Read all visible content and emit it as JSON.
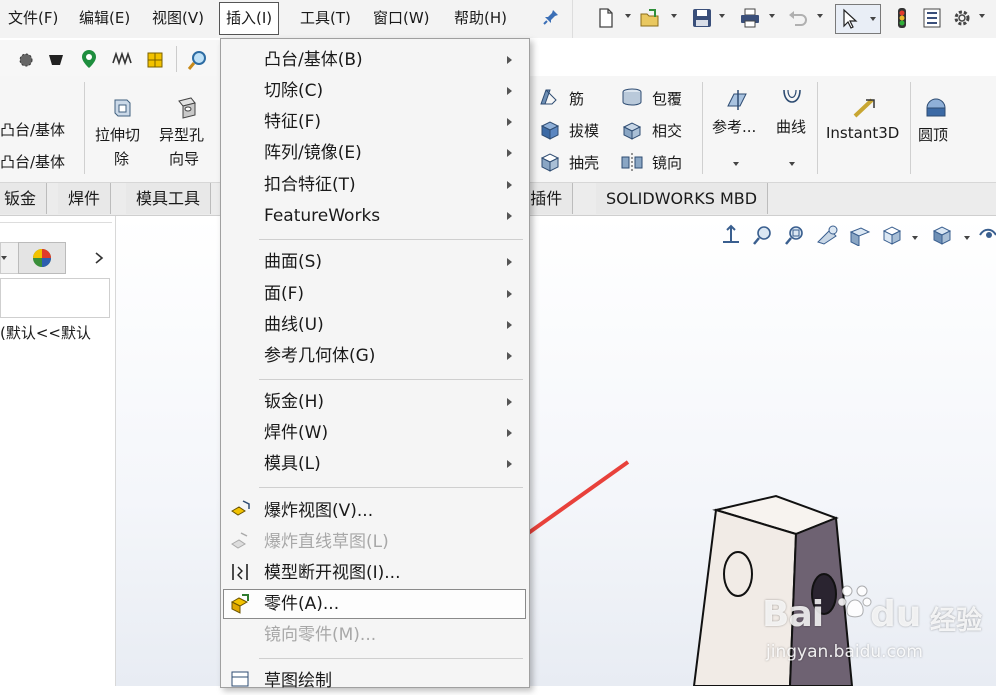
{
  "menubar": {
    "items": [
      {
        "label": "文件(F)"
      },
      {
        "label": "编辑(E)"
      },
      {
        "label": "视图(V)"
      },
      {
        "label": "插入(I)"
      },
      {
        "label": "工具(T)"
      },
      {
        "label": "窗口(W)"
      },
      {
        "label": "帮助(H)"
      }
    ]
  },
  "ribbon": {
    "left_cut_1": "凸台/基体",
    "left_cut_2": "凸台/基体",
    "extrude_cut_1": "拉伸切",
    "extrude_cut_2": "除",
    "hole_wizard_1": "异型孔",
    "hole_wizard_2": "向导",
    "rib": "筋",
    "wrap": "包覆",
    "draft": "拔模",
    "intersect": "相交",
    "shell": "抽壳",
    "mirror": "镜向",
    "reference": "参考...",
    "curves": "曲线",
    "instant3d": "Instant3D",
    "dome": "圆顶"
  },
  "tabs": {
    "sheet_metal": "钣金",
    "weldments": "焊件",
    "mold_tools": "模具工具",
    "addins_cut": "S 插件",
    "mbd": "SOLIDWORKS MBD"
  },
  "leftpanel": {
    "config_text": "(默认<<默认"
  },
  "dropdown": {
    "items": [
      {
        "label": "凸台/基体(B)"
      },
      {
        "label": "切除(C)"
      },
      {
        "label": "特征(F)"
      },
      {
        "label": "阵列/镜像(E)"
      },
      {
        "label": "扣合特征(T)"
      },
      {
        "label": "FeatureWorks"
      },
      {
        "label": "曲面(S)"
      },
      {
        "label": "面(F)"
      },
      {
        "label": "曲线(U)"
      },
      {
        "label": "参考几何体(G)"
      },
      {
        "label": "钣金(H)"
      },
      {
        "label": "焊件(W)"
      },
      {
        "label": "模具(L)"
      },
      {
        "label": "爆炸视图(V)..."
      },
      {
        "label": "爆炸直线草图(L)"
      },
      {
        "label": "模型断开视图(I)..."
      },
      {
        "label": "零件(A)..."
      },
      {
        "label": "镜向零件(M)..."
      },
      {
        "label": "草图绘制"
      }
    ]
  },
  "watermark": {
    "brand": "Bai",
    "brand2": "du",
    "cn": "经验",
    "url": "jingyan.baidu.com"
  },
  "colors": {
    "accent_arrow": "#e8413b",
    "part_face_light": "#f1ebe6",
    "part_face_dark": "#6e6272"
  }
}
